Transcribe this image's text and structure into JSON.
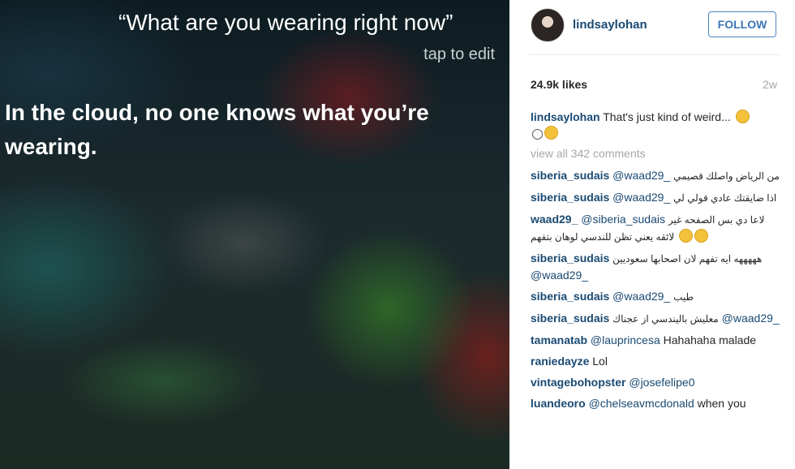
{
  "siri": {
    "query": "“What are you wearing right now”",
    "tap_to_edit": "tap to edit",
    "reply": "In the cloud, no one knows what you’re wearing."
  },
  "post": {
    "username": "lindsaylohan",
    "follow_label": "FOLLOW",
    "likes": "24.9k likes",
    "age": "2w",
    "caption_user": "lindsaylohan",
    "caption_text": "That's just kind of weird...",
    "view_all": "view all 342 comments"
  },
  "comments": [
    {
      "user": "siberia_sudais",
      "mention": "@waad29_",
      "text": "من الرياض واصلك قصيمي"
    },
    {
      "user": "siberia_sudais",
      "mention": "@waad29_",
      "text": "اذا ضايقتك عادي قولي لي"
    },
    {
      "user": "waad29_",
      "mention": "@siberia_sudais",
      "text": "لاعا دي بس الصفحه غير لائقه يعني تظن للندسي لوهان بتفهم"
    },
    {
      "user": "siberia_sudais",
      "mention": "@waad29_",
      "text": "هههههه ايه تفهم لان اصحابها سعوديين"
    },
    {
      "user": "siberia_sudais",
      "mention": "@waad29_",
      "text": "طيب"
    },
    {
      "user": "siberia_sudais",
      "mention": "@waad29_",
      "text": "معليش باليندسي از عجناك"
    },
    {
      "user": "tamanatab",
      "mention": "@lauprincesa",
      "text": "Hahahaha malade"
    },
    {
      "user": "raniedayze",
      "mention": "",
      "text": "Lol"
    },
    {
      "user": "vintagebohopster",
      "mention": "@josefelipe0",
      "text": ""
    },
    {
      "user": "luandeoro",
      "mention": "@chelseavmcdonald",
      "text": "when you"
    }
  ]
}
